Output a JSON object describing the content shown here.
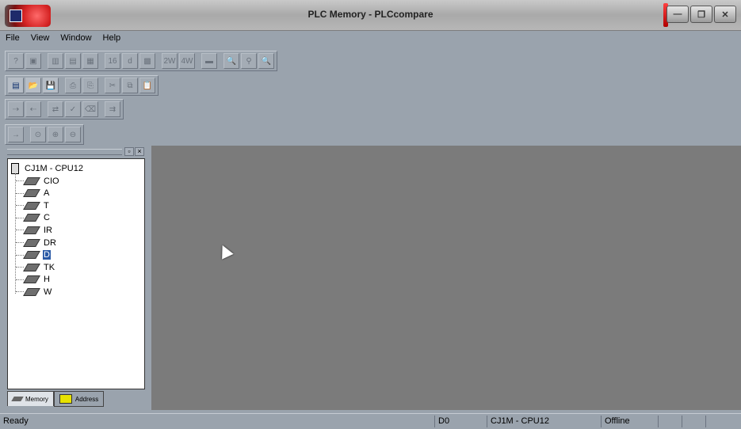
{
  "window": {
    "title": "PLC Memory - PLCcompare"
  },
  "menu": [
    "File",
    "View",
    "Window",
    "Help"
  ],
  "toolbar1": [
    {
      "icon": "monitor-icon",
      "text": "?"
    },
    {
      "icon": "plc-icon",
      "text": "▣"
    },
    {
      "icon": "ch-icon",
      "text": "▥"
    },
    {
      "icon": "bit-icon",
      "text": "▤"
    },
    {
      "icon": "word-icon",
      "text": "▦"
    },
    {
      "icon": "bin-icon",
      "text": "16"
    },
    {
      "icon": "dec-icon",
      "text": "d"
    },
    {
      "icon": "hex-icon",
      "text": "▩"
    },
    {
      "icon": "2w-icon",
      "text": "2W"
    },
    {
      "icon": "4w-icon",
      "text": "4W"
    },
    {
      "icon": "fill-icon",
      "text": "▬"
    },
    {
      "icon": "zoom-in-icon",
      "text": "🔍"
    },
    {
      "icon": "compare-icon",
      "text": "⚲"
    },
    {
      "icon": "find-icon",
      "text": "🔍"
    }
  ],
  "toolbar2": [
    {
      "icon": "new-project-icon",
      "text": "▤",
      "on": true
    },
    {
      "icon": "open-icon",
      "text": "📂",
      "on": true
    },
    {
      "icon": "save-icon",
      "text": "💾",
      "on": true
    },
    {
      "icon": "print-icon",
      "text": "⎙"
    },
    {
      "icon": "preview-icon",
      "text": "⎘"
    },
    {
      "icon": "cut-icon",
      "text": "✂"
    },
    {
      "icon": "copy-icon",
      "text": "⧉"
    },
    {
      "icon": "paste-icon",
      "text": "📋"
    }
  ],
  "toolbar3": [
    {
      "icon": "transfer-to-plc-icon",
      "text": "⇢"
    },
    {
      "icon": "transfer-from-plc-icon",
      "text": "⇠"
    },
    {
      "icon": "compare-plc-icon",
      "text": "⇄"
    },
    {
      "icon": "verify-icon",
      "text": "✓"
    },
    {
      "icon": "clear-icon",
      "text": "⌫"
    },
    {
      "icon": "online-icon",
      "text": "⇉"
    }
  ],
  "toolbar4": [
    {
      "icon": "go-online-icon",
      "text": "→"
    },
    {
      "icon": "monitor-mode-icon",
      "text": "⊙"
    },
    {
      "icon": "force-set-icon",
      "text": "⊕"
    },
    {
      "icon": "force-reset-icon",
      "text": "⊖"
    }
  ],
  "tree": {
    "root": "CJ1M - CPU12",
    "items": [
      "CIO",
      "A",
      "T",
      "C",
      "IR",
      "DR",
      "D",
      "TK",
      "H",
      "W"
    ],
    "selected": "D"
  },
  "tabs": [
    "Memory",
    "Address"
  ],
  "status": {
    "message": "Ready",
    "area": "D0",
    "device": "CJ1M - CPU12",
    "mode": "Offline"
  }
}
